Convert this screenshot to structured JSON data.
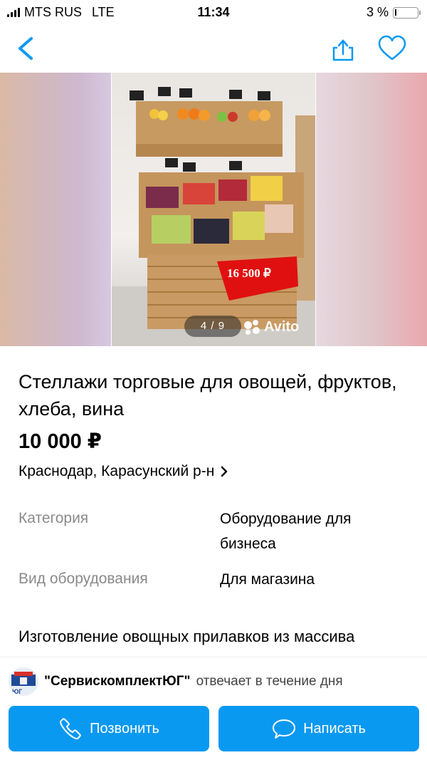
{
  "status_bar": {
    "carrier": "MTS RUS",
    "network": "LTE",
    "time": "11:34",
    "battery": "3 %"
  },
  "nav": {
    "back_icon": "chevron-left-icon",
    "share_icon": "share-icon",
    "favorite_icon": "heart-icon",
    "accent_color": "#0a99f0"
  },
  "gallery": {
    "counter": "4 / 9",
    "watermark": "Avito",
    "price_tag": "16 500 ₽",
    "current_photo": 4,
    "total_photos": 9
  },
  "listing": {
    "title": "Стеллажи торговые для овощей, фруктов, хлеба, вина",
    "price": "10 000 ₽",
    "location": "Краснодар, Карасунский р-н",
    "params": [
      {
        "name": "Категория",
        "value": "Оборудование для бизнеса"
      },
      {
        "name": "Вид оборудования",
        "value": "Для магазина"
      }
    ],
    "description": "Изготовление овощных прилавков из массива"
  },
  "seller": {
    "name": "\"СервискомплектЮГ\"",
    "response": "отвечает в течение дня",
    "logo_text": "ЮГ"
  },
  "actions": {
    "call_label": "Позвонить",
    "message_label": "Написать",
    "call_icon": "phone-icon",
    "message_icon": "chat-bubble-icon"
  }
}
